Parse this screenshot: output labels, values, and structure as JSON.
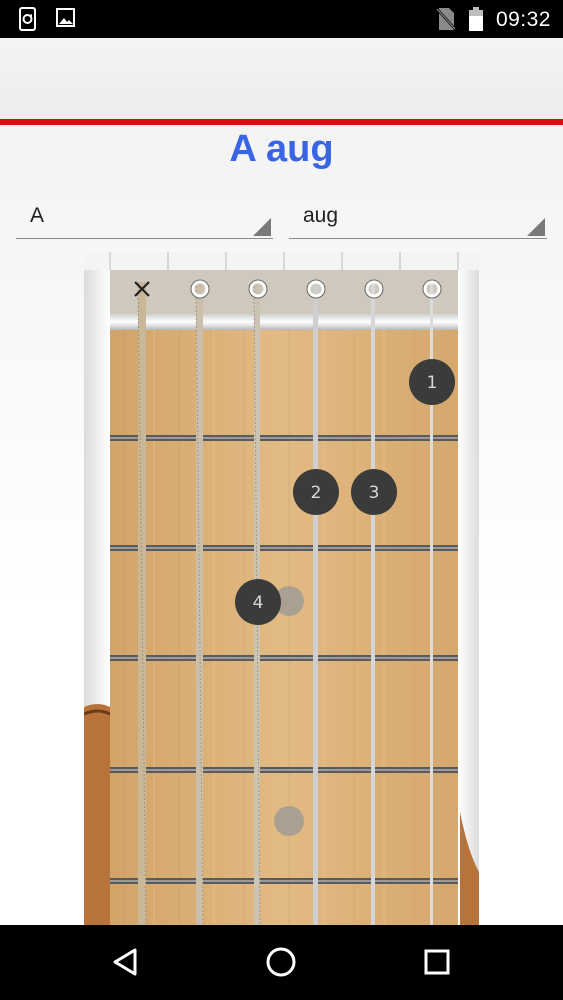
{
  "status_bar": {
    "time": "09:32",
    "left_icons": [
      "sync-icon",
      "image-icon"
    ],
    "right_icons": [
      "no-sim-icon",
      "battery-icon"
    ]
  },
  "chord": {
    "title": "A aug",
    "root_select": {
      "value": "A"
    },
    "type_select": {
      "value": "aug"
    }
  },
  "fretboard": {
    "string_markers": [
      "X",
      "O",
      "O",
      "O",
      "O",
      "O"
    ],
    "fingers": [
      {
        "label": "1",
        "string": 6,
        "fret": 1
      },
      {
        "label": "2",
        "string": 4,
        "fret": 2
      },
      {
        "label": "3",
        "string": 5,
        "fret": 2
      },
      {
        "label": "4",
        "string": 3,
        "fret": 3
      }
    ],
    "inlay_frets": [
      3,
      5
    ]
  },
  "nav_bar": {
    "buttons": [
      "back-icon",
      "home-icon",
      "recents-icon"
    ]
  },
  "colors": {
    "accent_title": "#3a64e6",
    "header_rule": "#d80f0f",
    "wood": "#d9b077",
    "finger_dot": "#3b3b3b"
  }
}
